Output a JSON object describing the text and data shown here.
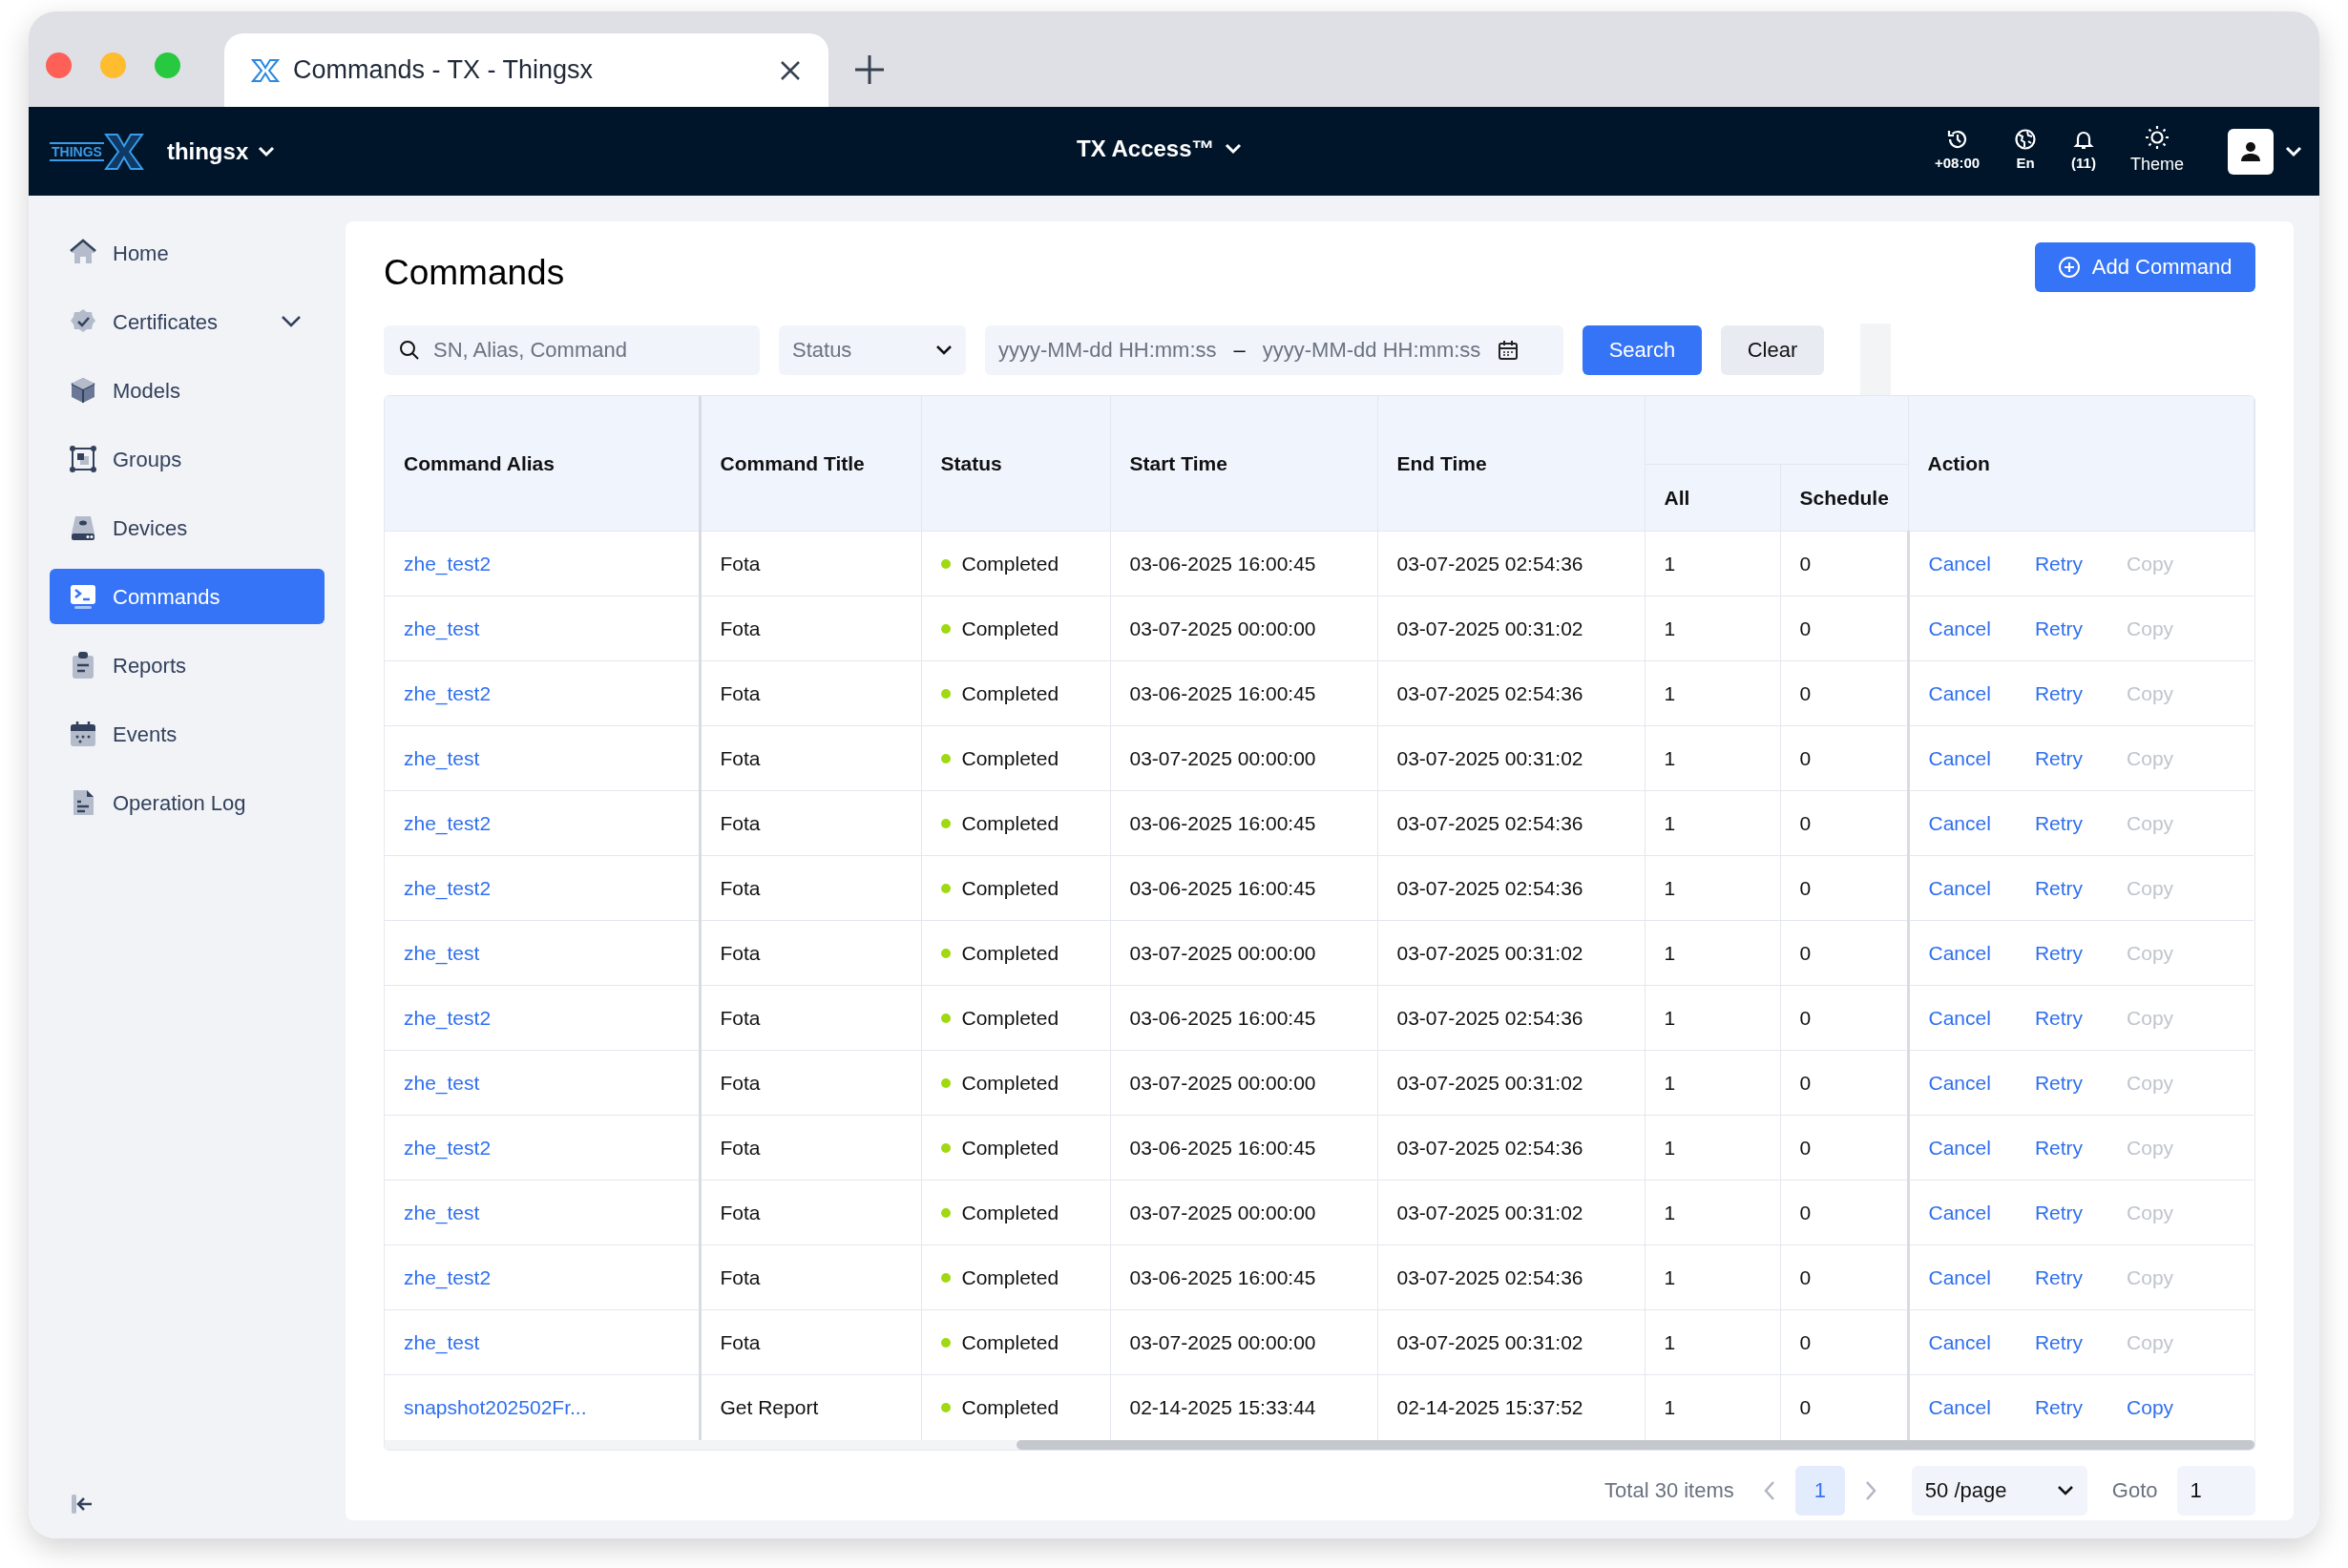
{
  "browser": {
    "tab_title": "Commands - TX - Thingsx"
  },
  "top_nav": {
    "logo_text": "THINGS",
    "workspace": "thingsx",
    "product": "TX Access™",
    "tools": [
      {
        "kind": "timezone",
        "label": "+08:00"
      },
      {
        "kind": "language",
        "label": "En"
      },
      {
        "kind": "notifications",
        "label": "(11)"
      },
      {
        "kind": "theme",
        "label": "Theme"
      }
    ]
  },
  "sidebar": {
    "items": [
      {
        "kind": "home",
        "label": "Home",
        "selected": false,
        "expandable": false
      },
      {
        "kind": "certificate",
        "label": "Certificates",
        "selected": false,
        "expandable": true
      },
      {
        "kind": "cube",
        "label": "Models",
        "selected": false,
        "expandable": false
      },
      {
        "kind": "group",
        "label": "Groups",
        "selected": false,
        "expandable": false
      },
      {
        "kind": "device",
        "label": "Devices",
        "selected": false,
        "expandable": false
      },
      {
        "kind": "terminal",
        "label": "Commands",
        "selected": true,
        "expandable": false
      },
      {
        "kind": "clipboard",
        "label": "Reports",
        "selected": false,
        "expandable": false
      },
      {
        "kind": "calendar",
        "label": "Events",
        "selected": false,
        "expandable": false
      },
      {
        "kind": "document",
        "label": "Operation Log",
        "selected": false,
        "expandable": false
      }
    ]
  },
  "page": {
    "title": "Commands",
    "add_button": "Add Command"
  },
  "filters": {
    "search_placeholder": "SN, Alias, Command",
    "status_placeholder": "Status",
    "start_placeholder": "yyyy-MM-dd HH:mm:ss",
    "separator": "–",
    "end_placeholder": "yyyy-MM-dd HH:mm:ss",
    "search_button": "Search",
    "clear_button": "Clear"
  },
  "table": {
    "columns": [
      {
        "label": "Command Alias"
      },
      {
        "label": "Command Title"
      },
      {
        "label": "Status"
      },
      {
        "label": "Start Time"
      },
      {
        "label": "End Time"
      },
      {
        "children": [
          "All",
          "Schedule"
        ]
      },
      {
        "label": "Action"
      }
    ],
    "rows": [
      {
        "alias": "zhe_test2",
        "title": "Fota",
        "status": "Completed",
        "color": "#a0d911",
        "start": "03-06-2025 16:00:45",
        "end": "03-07-2025 02:54:36",
        "all": "1",
        "schedule": "0",
        "actions": [
          {
            "label": "Cancel",
            "disabled": false
          },
          {
            "label": "Retry",
            "disabled": false
          },
          {
            "label": "Copy",
            "disabled": true
          }
        ]
      },
      {
        "alias": "zhe_test",
        "title": "Fota",
        "status": "Completed",
        "color": "#a0d911",
        "start": "03-07-2025 00:00:00",
        "end": "03-07-2025 00:31:02",
        "all": "1",
        "schedule": "0",
        "actions": [
          {
            "label": "Cancel",
            "disabled": false
          },
          {
            "label": "Retry",
            "disabled": false
          },
          {
            "label": "Copy",
            "disabled": true
          }
        ]
      },
      {
        "alias": "zhe_test2",
        "title": "Fota",
        "status": "Completed",
        "color": "#a0d911",
        "start": "03-06-2025 16:00:45",
        "end": "03-07-2025 02:54:36",
        "all": "1",
        "schedule": "0",
        "actions": [
          {
            "label": "Cancel",
            "disabled": false
          },
          {
            "label": "Retry",
            "disabled": false
          },
          {
            "label": "Copy",
            "disabled": true
          }
        ]
      },
      {
        "alias": "zhe_test",
        "title": "Fota",
        "status": "Completed",
        "color": "#a0d911",
        "start": "03-07-2025 00:00:00",
        "end": "03-07-2025 00:31:02",
        "all": "1",
        "schedule": "0",
        "actions": [
          {
            "label": "Cancel",
            "disabled": false
          },
          {
            "label": "Retry",
            "disabled": false
          },
          {
            "label": "Copy",
            "disabled": true
          }
        ]
      },
      {
        "alias": "zhe_test2",
        "title": "Fota",
        "status": "Completed",
        "color": "#a0d911",
        "start": "03-06-2025 16:00:45",
        "end": "03-07-2025 02:54:36",
        "all": "1",
        "schedule": "0",
        "actions": [
          {
            "label": "Cancel",
            "disabled": false
          },
          {
            "label": "Retry",
            "disabled": false
          },
          {
            "label": "Copy",
            "disabled": true
          }
        ]
      },
      {
        "alias": "zhe_test2",
        "title": "Fota",
        "status": "Completed",
        "color": "#a0d911",
        "start": "03-06-2025 16:00:45",
        "end": "03-07-2025 02:54:36",
        "all": "1",
        "schedule": "0",
        "actions": [
          {
            "label": "Cancel",
            "disabled": false
          },
          {
            "label": "Retry",
            "disabled": false
          },
          {
            "label": "Copy",
            "disabled": true
          }
        ]
      },
      {
        "alias": "zhe_test",
        "title": "Fota",
        "status": "Completed",
        "color": "#a0d911",
        "start": "03-07-2025 00:00:00",
        "end": "03-07-2025 00:31:02",
        "all": "1",
        "schedule": "0",
        "actions": [
          {
            "label": "Cancel",
            "disabled": false
          },
          {
            "label": "Retry",
            "disabled": false
          },
          {
            "label": "Copy",
            "disabled": true
          }
        ]
      },
      {
        "alias": "zhe_test2",
        "title": "Fota",
        "status": "Completed",
        "color": "#a0d911",
        "start": "03-06-2025 16:00:45",
        "end": "03-07-2025 02:54:36",
        "all": "1",
        "schedule": "0",
        "actions": [
          {
            "label": "Cancel",
            "disabled": false
          },
          {
            "label": "Retry",
            "disabled": false
          },
          {
            "label": "Copy",
            "disabled": true
          }
        ]
      },
      {
        "alias": "zhe_test",
        "title": "Fota",
        "status": "Completed",
        "color": "#a0d911",
        "start": "03-07-2025 00:00:00",
        "end": "03-07-2025 00:31:02",
        "all": "1",
        "schedule": "0",
        "actions": [
          {
            "label": "Cancel",
            "disabled": false
          },
          {
            "label": "Retry",
            "disabled": false
          },
          {
            "label": "Copy",
            "disabled": true
          }
        ]
      },
      {
        "alias": "zhe_test2",
        "title": "Fota",
        "status": "Completed",
        "color": "#a0d911",
        "start": "03-06-2025 16:00:45",
        "end": "03-07-2025 02:54:36",
        "all": "1",
        "schedule": "0",
        "actions": [
          {
            "label": "Cancel",
            "disabled": false
          },
          {
            "label": "Retry",
            "disabled": false
          },
          {
            "label": "Copy",
            "disabled": true
          }
        ]
      },
      {
        "alias": "zhe_test",
        "title": "Fota",
        "status": "Completed",
        "color": "#a0d911",
        "start": "03-07-2025 00:00:00",
        "end": "03-07-2025 00:31:02",
        "all": "1",
        "schedule": "0",
        "actions": [
          {
            "label": "Cancel",
            "disabled": false
          },
          {
            "label": "Retry",
            "disabled": false
          },
          {
            "label": "Copy",
            "disabled": true
          }
        ]
      },
      {
        "alias": "zhe_test2",
        "title": "Fota",
        "status": "Completed",
        "color": "#a0d911",
        "start": "03-06-2025 16:00:45",
        "end": "03-07-2025 02:54:36",
        "all": "1",
        "schedule": "0",
        "actions": [
          {
            "label": "Cancel",
            "disabled": false
          },
          {
            "label": "Retry",
            "disabled": false
          },
          {
            "label": "Copy",
            "disabled": true
          }
        ]
      },
      {
        "alias": "zhe_test",
        "title": "Fota",
        "status": "Completed",
        "color": "#a0d911",
        "start": "03-07-2025 00:00:00",
        "end": "03-07-2025 00:31:02",
        "all": "1",
        "schedule": "0",
        "actions": [
          {
            "label": "Cancel",
            "disabled": false
          },
          {
            "label": "Retry",
            "disabled": false
          },
          {
            "label": "Copy",
            "disabled": true
          }
        ]
      },
      {
        "alias": "snapshot202502Fr...",
        "title": "Get Report",
        "status": "Completed",
        "color": "#a0d911",
        "start": "02-14-2025 15:33:44",
        "end": "02-14-2025 15:37:52",
        "all": "1",
        "schedule": "0",
        "actions": [
          {
            "label": "Cancel",
            "disabled": false
          },
          {
            "label": "Retry",
            "disabled": false
          },
          {
            "label": "Copy",
            "disabled": false
          }
        ]
      }
    ]
  },
  "pagination": {
    "total": "Total 30 items",
    "current_page": "1",
    "page_size": "50 /page",
    "goto_label": "Goto",
    "goto_value": "1"
  }
}
